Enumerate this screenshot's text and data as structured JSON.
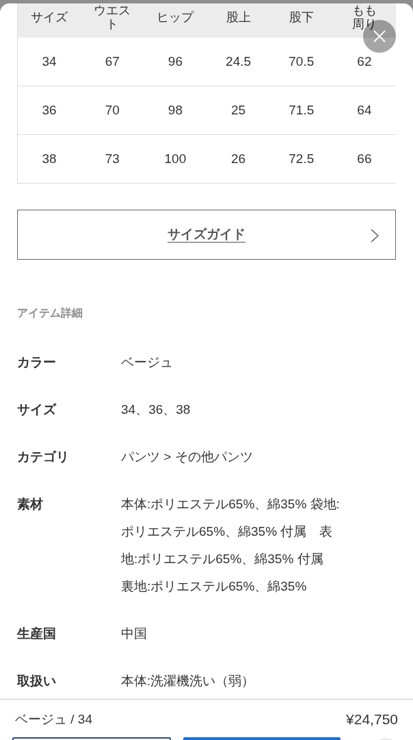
{
  "size_table": {
    "columns": [
      "サイズ",
      "ウエスト",
      "ヒップ",
      "股上",
      "股下",
      "もも周り"
    ],
    "rows": [
      [
        "34",
        "67",
        "96",
        "24.5",
        "70.5",
        "62"
      ],
      [
        "36",
        "70",
        "98",
        "25",
        "71.5",
        "64"
      ],
      [
        "38",
        "73",
        "100",
        "26",
        "72.5",
        "66"
      ]
    ]
  },
  "size_guide_button": {
    "label": "サイズガイド"
  },
  "item_details": {
    "heading": "アイテム詳細",
    "rows": [
      {
        "label": "カラー",
        "lines": [
          "ベージュ"
        ]
      },
      {
        "label": "サイズ",
        "lines": [
          "34、36、38"
        ]
      },
      {
        "label": "カテゴリ",
        "lines": [
          "パンツ > その他パンツ"
        ]
      },
      {
        "label": "素材",
        "lines": [
          "本体:ポリエステル65%、綿35% 袋地:",
          "ポリエステル65%、綿35% 付属　表",
          "地:ポリエステル65%、綿35% 付属",
          "裏地:ポリエステル65%、綿35%"
        ]
      },
      {
        "label": "生産国",
        "lines": [
          "中国"
        ]
      },
      {
        "label": "取扱い",
        "lines": [
          "本体:洗濯機洗い（弱）"
        ]
      }
    ]
  },
  "footer": {
    "selection": "ベージュ / 34",
    "price": "¥24,750"
  }
}
